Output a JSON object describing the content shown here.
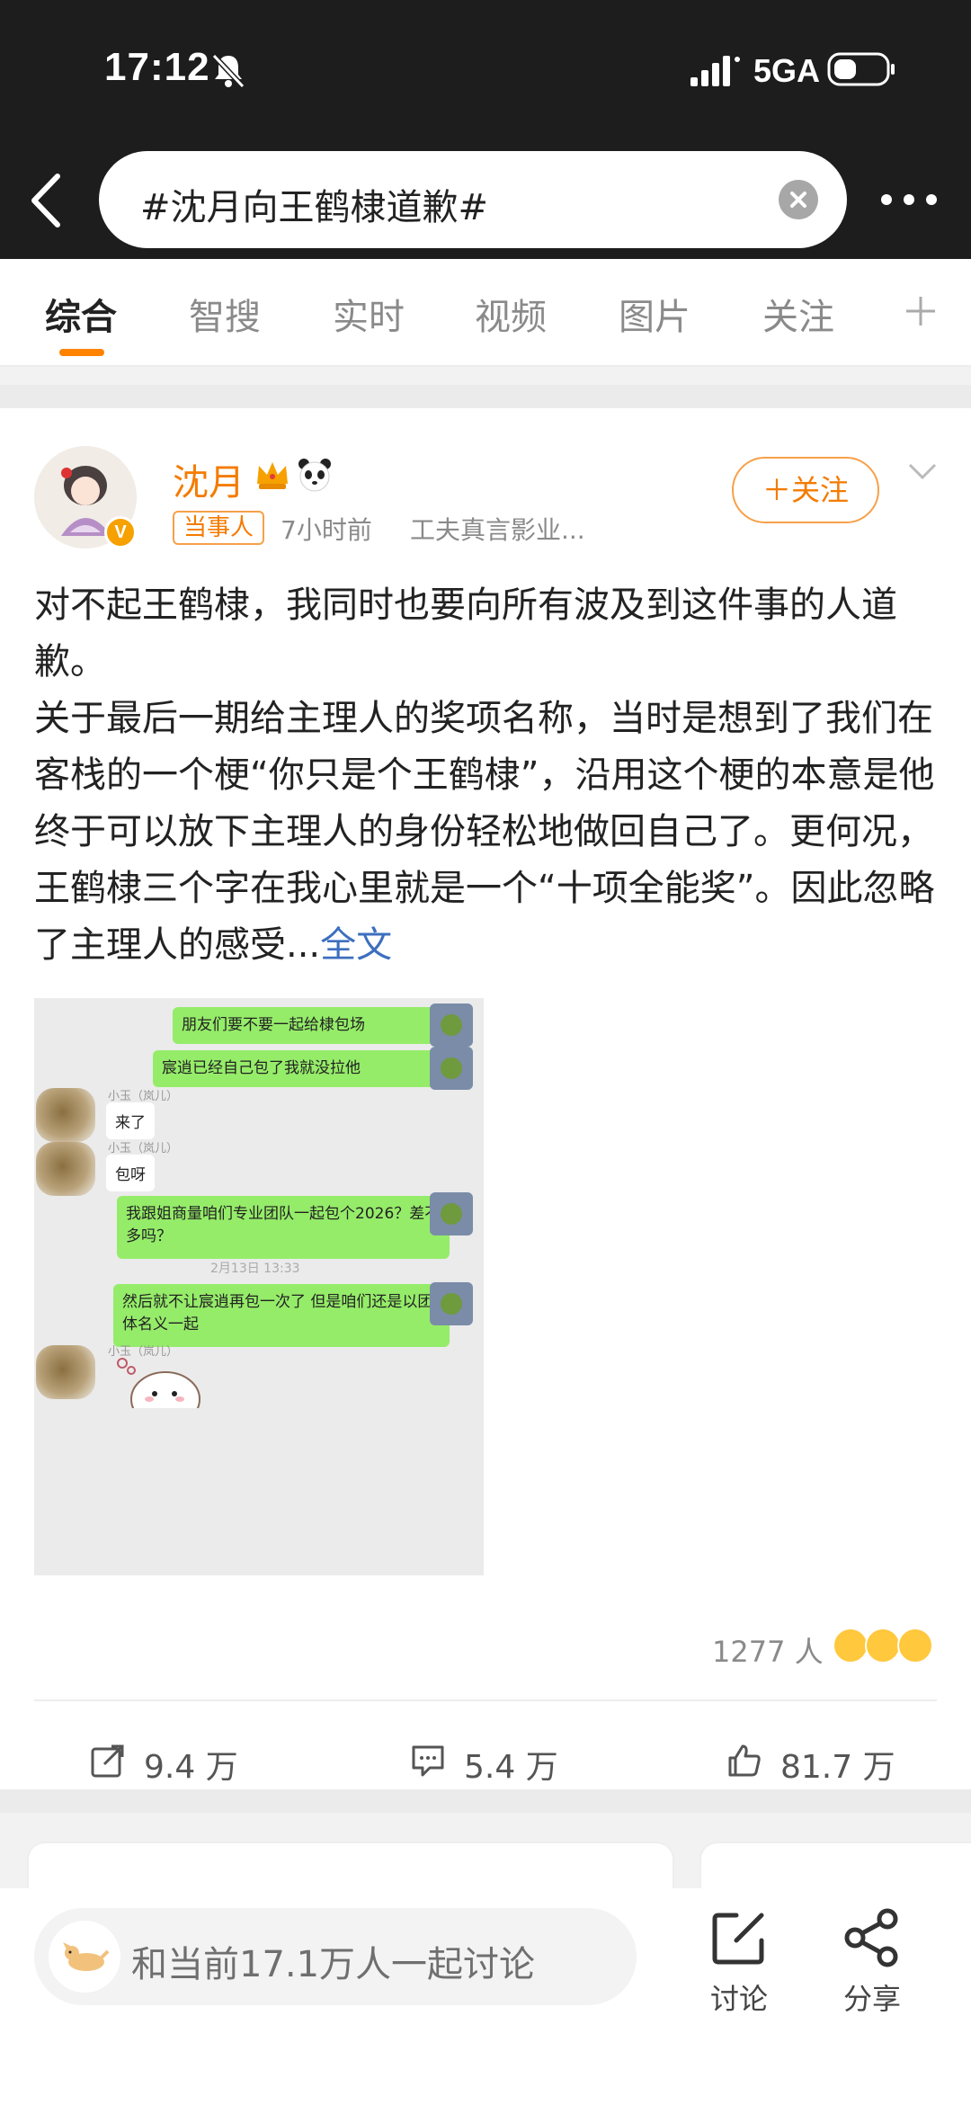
{
  "status_bar": {
    "time": "17:12",
    "network": "5GA"
  },
  "search": {
    "query": "#沈月向王鹤棣道歉#"
  },
  "tabs": [
    {
      "label": "综合",
      "active": true
    },
    {
      "label": "智搜"
    },
    {
      "label": "实时"
    },
    {
      "label": "视频"
    },
    {
      "label": "图片"
    },
    {
      "label": "关注"
    }
  ],
  "post": {
    "username": "沈月",
    "tag": "当事人",
    "time": "7小时前",
    "source": "工夫真言影业...",
    "follow_label": "＋关注",
    "paragraph1": "对不起王鹤棣，我同时也要向所有波及到这件事的人道歉。",
    "paragraph2": "关于最后一期给主理人的奖项名称，当时是想到了我们在客栈的一个梗“你只是个王鹤棣”，沿用这个梗的本意是他终于可以放下主理人的身份轻松地做回自己了。更何况，王鹤棣三个字在我心里就是一个“十项全能奖”。因此忽略了主理人的感受...",
    "full_text_link": "全文",
    "liker_count": "1277 人",
    "actions": {
      "repost": "9.4 万",
      "comment": "5.4 万",
      "like": "81.7 万"
    }
  },
  "chat_image": {
    "messages": [
      {
        "side": "right",
        "text": "朋友们要不要一起给棣包场"
      },
      {
        "side": "right",
        "text": "宸逍已经自己包了我就没拉他"
      },
      {
        "side": "left",
        "name": "小玉（岚儿）",
        "text": "来了"
      },
      {
        "side": "left",
        "name": "小玉（岚儿）",
        "text": "包呀"
      },
      {
        "side": "right",
        "text": "我跟姐商量咱们专业团队一起包个2026？差不多吗？"
      },
      {
        "side": "right",
        "text": "然后就不让宸逍再包一次了 但是咱们还是以团体名义一起"
      },
      {
        "side": "left",
        "name": "小玉（岚儿）"
      }
    ],
    "timestamp": "2月13日 13:33"
  },
  "bottom_bar": {
    "discuss_text": "和当前17.1万人一起讨论",
    "discuss_button": "讨论",
    "share_button": "分享"
  },
  "colors": {
    "accent": "#ff8200",
    "username": "#f47b00",
    "link": "#3d6fbf",
    "wechat_green": "#95ec69"
  }
}
